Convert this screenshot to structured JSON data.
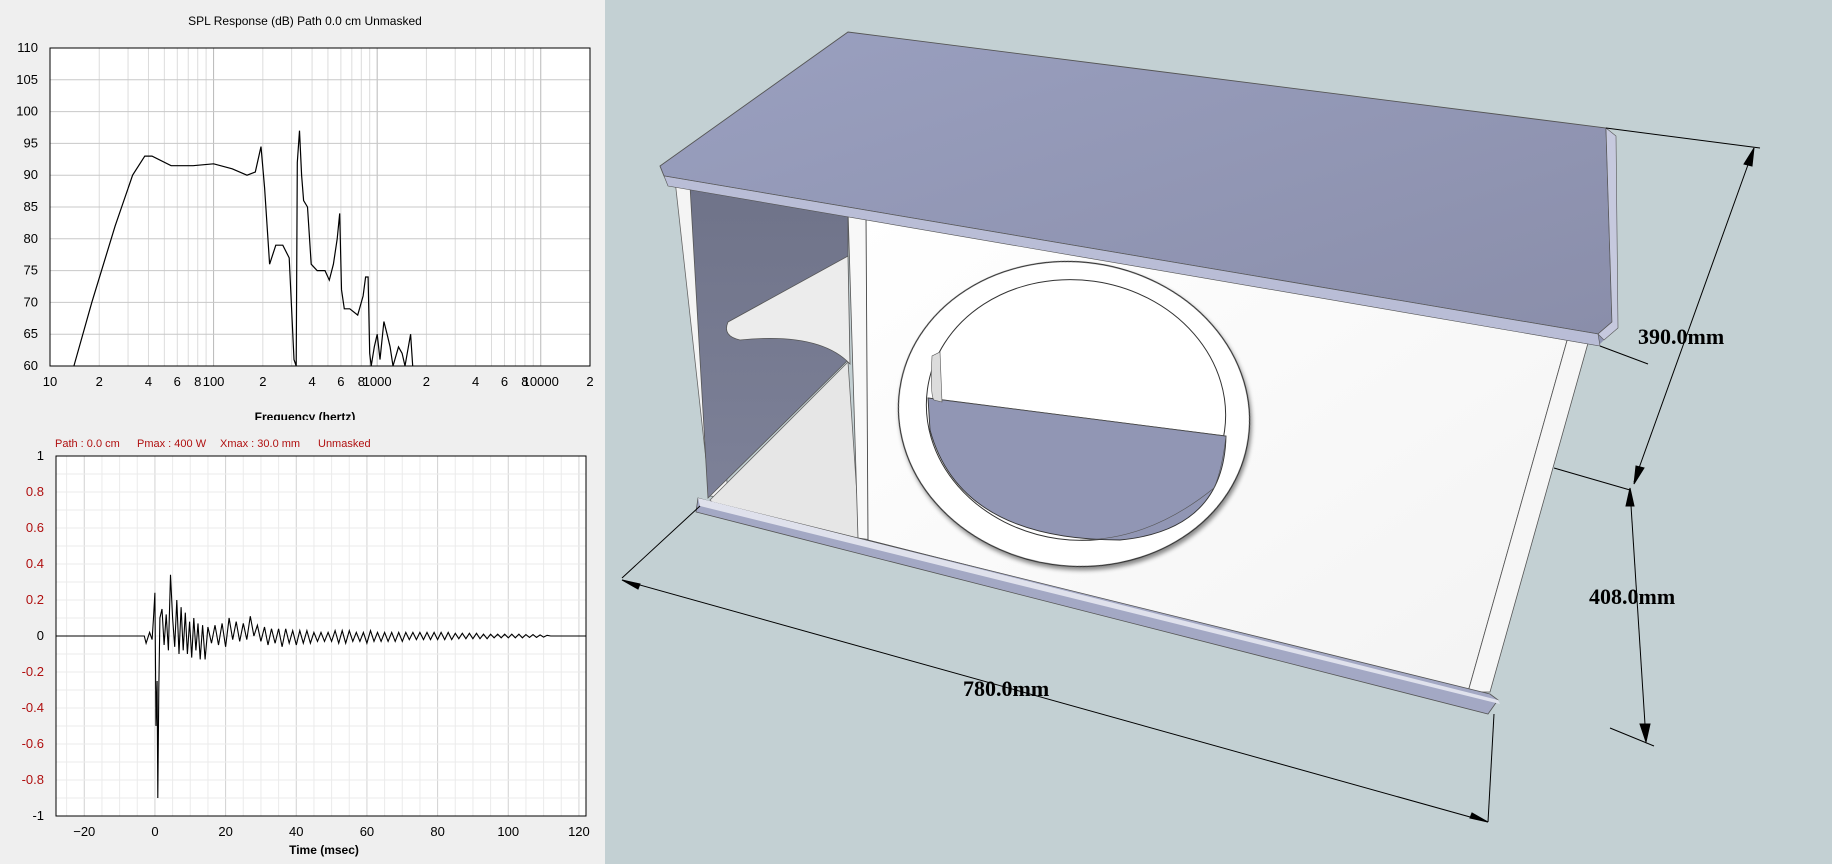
{
  "spl_panel": {
    "title": "SPL Response (dB)   Path 0.0 cm   Unmasked",
    "xlabel": "Frequency (hertz)"
  },
  "impulse_panel": {
    "status_path": "Path : 0.0 cm",
    "status_pmax": "Pmax : 400 W",
    "status_xmax": "Xmax : 30.0 mm",
    "status_mask": "Unmasked",
    "xlabel": "Time (msec)"
  },
  "colors": {
    "panel_bg": "#efefef",
    "grid": "#d8d8d8",
    "status_red": "#b01010",
    "scene_bg": "#c3d0d3",
    "box_white": "#ffffff",
    "box_lavender": "#9498b2",
    "box_dark": "#6e7289"
  },
  "chart_data": [
    {
      "type": "line",
      "title": "SPL Response (dB)   Path 0.0 cm   Unmasked",
      "xlabel": "Frequency (hertz)",
      "ylabel": "",
      "x_scale": "log",
      "xlim": [
        10,
        20000
      ],
      "ylim": [
        60,
        110
      ],
      "yticks": [
        60,
        65,
        70,
        75,
        80,
        85,
        90,
        95,
        100,
        105,
        110
      ],
      "xtick_labels": [
        {
          "x": 10,
          "label": "10"
        },
        {
          "x": 20,
          "label": "2"
        },
        {
          "x": 40,
          "label": "4"
        },
        {
          "x": 60,
          "label": "6"
        },
        {
          "x": 80,
          "label": "8"
        },
        {
          "x": 100,
          "label": "100"
        },
        {
          "x": 200,
          "label": "2"
        },
        {
          "x": 400,
          "label": "4"
        },
        {
          "x": 600,
          "label": "6"
        },
        {
          "x": 800,
          "label": "8"
        },
        {
          "x": 1000,
          "label": "1000"
        },
        {
          "x": 2000,
          "label": "2"
        },
        {
          "x": 4000,
          "label": "4"
        },
        {
          "x": 6000,
          "label": "6"
        },
        {
          "x": 8000,
          "label": "8"
        },
        {
          "x": 10000,
          "label": "10000"
        },
        {
          "x": 20000,
          "label": "2"
        }
      ],
      "grid": true,
      "series": [
        {
          "points": [
            [
              14,
              60
            ],
            [
              18,
              70
            ],
            [
              25,
              82
            ],
            [
              32,
              90
            ],
            [
              38,
              93
            ],
            [
              42,
              93
            ],
            [
              55,
              91.5
            ],
            [
              75,
              91.5
            ],
            [
              100,
              91.8
            ],
            [
              130,
              91
            ],
            [
              160,
              90
            ],
            [
              180,
              90.5
            ],
            [
              195,
              94.5
            ],
            [
              205,
              88
            ],
            [
              220,
              76
            ],
            [
              240,
              79
            ],
            [
              265,
              79
            ],
            [
              290,
              77
            ],
            [
              310,
              61
            ],
            [
              320,
              60
            ],
            [
              325,
              92
            ],
            [
              335,
              97
            ],
            [
              345,
              90
            ],
            [
              355,
              86
            ],
            [
              375,
              85
            ],
            [
              395,
              76
            ],
            [
              430,
              75
            ],
            [
              480,
              75
            ],
            [
              510,
              73.5
            ],
            [
              540,
              76
            ],
            [
              570,
              80
            ],
            [
              590,
              84
            ],
            [
              605,
              72
            ],
            [
              630,
              69
            ],
            [
              680,
              69
            ],
            [
              760,
              68
            ],
            [
              820,
              71
            ],
            [
              850,
              74
            ],
            [
              880,
              74
            ],
            [
              900,
              62
            ],
            [
              920,
              60
            ],
            [
              960,
              63
            ],
            [
              1000,
              65
            ],
            [
              1040,
              61
            ],
            [
              1100,
              67
            ],
            [
              1150,
              65
            ],
            [
              1200,
              63
            ],
            [
              1250,
              60
            ],
            [
              1350,
              63
            ],
            [
              1420,
              62
            ],
            [
              1480,
              60
            ],
            [
              1600,
              65
            ],
            [
              1650,
              60
            ]
          ]
        }
      ]
    },
    {
      "type": "line",
      "title": "",
      "xlabel": "Time (msec)",
      "ylabel": "",
      "xlim": [
        -28,
        122
      ],
      "ylim": [
        -1,
        1
      ],
      "xticks": [
        -20,
        0,
        20,
        40,
        60,
        80,
        100,
        120
      ],
      "yticks": [
        -1,
        -0.8,
        -0.6,
        -0.4,
        -0.2,
        0,
        0.2,
        0.4,
        0.6,
        0.8,
        1
      ],
      "grid": true,
      "series": [
        {
          "points": [
            [
              -28,
              0
            ],
            [
              -3,
              0
            ],
            [
              -2.5,
              -0.04
            ],
            [
              -1.5,
              0.02
            ],
            [
              -0.8,
              -0.02
            ],
            [
              -0.4,
              0.1
            ],
            [
              0,
              0.24
            ],
            [
              0.3,
              -0.5
            ],
            [
              0.6,
              -0.25
            ],
            [
              0.8,
              -0.9
            ],
            [
              1.1,
              -0.3
            ],
            [
              1.4,
              0.1
            ],
            [
              2,
              0.15
            ],
            [
              2.6,
              -0.05
            ],
            [
              3.2,
              0.12
            ],
            [
              3.8,
              -0.08
            ],
            [
              4.4,
              0.34
            ],
            [
              5,
              0.1
            ],
            [
              5.6,
              -0.06
            ],
            [
              6.2,
              0.2
            ],
            [
              6.8,
              -0.1
            ],
            [
              7.4,
              0.16
            ],
            [
              8,
              -0.08
            ],
            [
              8.6,
              0.13
            ],
            [
              9.2,
              -0.1
            ],
            [
              9.8,
              0.08
            ],
            [
              10.4,
              -0.12
            ],
            [
              11,
              0.1
            ],
            [
              11.6,
              -0.08
            ],
            [
              12.2,
              0.07
            ],
            [
              12.8,
              -0.13
            ],
            [
              13.5,
              0.06
            ],
            [
              14.2,
              -0.13
            ],
            [
              15,
              0.05
            ],
            [
              16,
              -0.04
            ],
            [
              17,
              0.06
            ],
            [
              18,
              -0.05
            ],
            [
              19,
              0.07
            ],
            [
              20,
              -0.06
            ],
            [
              21,
              0.1
            ],
            [
              22,
              -0.02
            ],
            [
              23,
              0.08
            ],
            [
              24,
              -0.03
            ],
            [
              25,
              0.07
            ],
            [
              26,
              -0.02
            ],
            [
              27,
              0.11
            ],
            [
              28,
              0
            ],
            [
              29,
              0.06
            ],
            [
              30,
              -0.03
            ],
            [
              31,
              0.05
            ],
            [
              32,
              -0.05
            ],
            [
              33,
              0.04
            ],
            [
              34,
              -0.04
            ],
            [
              35,
              0.04
            ],
            [
              36,
              -0.06
            ],
            [
              37,
              0.04
            ],
            [
              38,
              -0.04
            ],
            [
              39,
              0.03
            ],
            [
              40,
              -0.05
            ],
            [
              41,
              0.03
            ],
            [
              42,
              -0.04
            ],
            [
              43,
              0.03
            ],
            [
              44,
              -0.04
            ],
            [
              45,
              0.02
            ],
            [
              46,
              -0.03
            ],
            [
              47,
              0.02
            ],
            [
              48,
              -0.03
            ],
            [
              49,
              0.02
            ],
            [
              50,
              -0.03
            ],
            [
              51,
              0.03
            ],
            [
              52,
              -0.04
            ],
            [
              53,
              0.03
            ],
            [
              54,
              -0.04
            ],
            [
              55,
              0.03
            ],
            [
              56,
              -0.03
            ],
            [
              57,
              0.02
            ],
            [
              58,
              -0.03
            ],
            [
              59,
              0.02
            ],
            [
              60,
              -0.04
            ],
            [
              61,
              0.03
            ],
            [
              62,
              -0.03
            ],
            [
              63,
              0.02
            ],
            [
              64,
              -0.03
            ],
            [
              65,
              0.02
            ],
            [
              66,
              -0.03
            ],
            [
              67,
              0.02
            ],
            [
              68,
              -0.03
            ],
            [
              69,
              0.02
            ],
            [
              70,
              -0.03
            ],
            [
              71,
              0.02
            ],
            [
              72,
              -0.02
            ],
            [
              73,
              0.02
            ],
            [
              74,
              -0.02
            ],
            [
              75,
              0.02
            ],
            [
              76,
              -0.02
            ],
            [
              77,
              0.02
            ],
            [
              78,
              -0.02
            ],
            [
              79,
              0.02
            ],
            [
              80,
              -0.02
            ],
            [
              81,
              0.02
            ],
            [
              82,
              -0.02
            ],
            [
              83,
              0.02
            ],
            [
              84,
              -0.02
            ],
            [
              85,
              0.015
            ],
            [
              86,
              -0.015
            ],
            [
              87,
              0.015
            ],
            [
              88,
              -0.015
            ],
            [
              89,
              0.015
            ],
            [
              90,
              -0.015
            ],
            [
              91,
              0.015
            ],
            [
              92,
              -0.015
            ],
            [
              93,
              0.01
            ],
            [
              94,
              -0.015
            ],
            [
              95,
              0.01
            ],
            [
              96,
              -0.01
            ],
            [
              97,
              0.01
            ],
            [
              98,
              -0.01
            ],
            [
              99,
              0.01
            ],
            [
              100,
              -0.01
            ],
            [
              101,
              0.01
            ],
            [
              102,
              -0.01
            ],
            [
              103,
              0.01
            ],
            [
              104,
              -0.01
            ],
            [
              105,
              0.008
            ],
            [
              106,
              -0.008
            ],
            [
              107,
              0.008
            ],
            [
              108,
              -0.008
            ],
            [
              109,
              0.006
            ],
            [
              110,
              -0.006
            ],
            [
              111,
              0.004
            ],
            [
              112,
              0
            ],
            [
              122,
              0
            ]
          ]
        }
      ]
    }
  ],
  "enclosure_view": {
    "dimensions": [
      {
        "name": "width",
        "label": "780.0mm"
      },
      {
        "name": "height",
        "label": "408.0mm"
      },
      {
        "name": "depth",
        "label": "390.0mm"
      }
    ]
  }
}
